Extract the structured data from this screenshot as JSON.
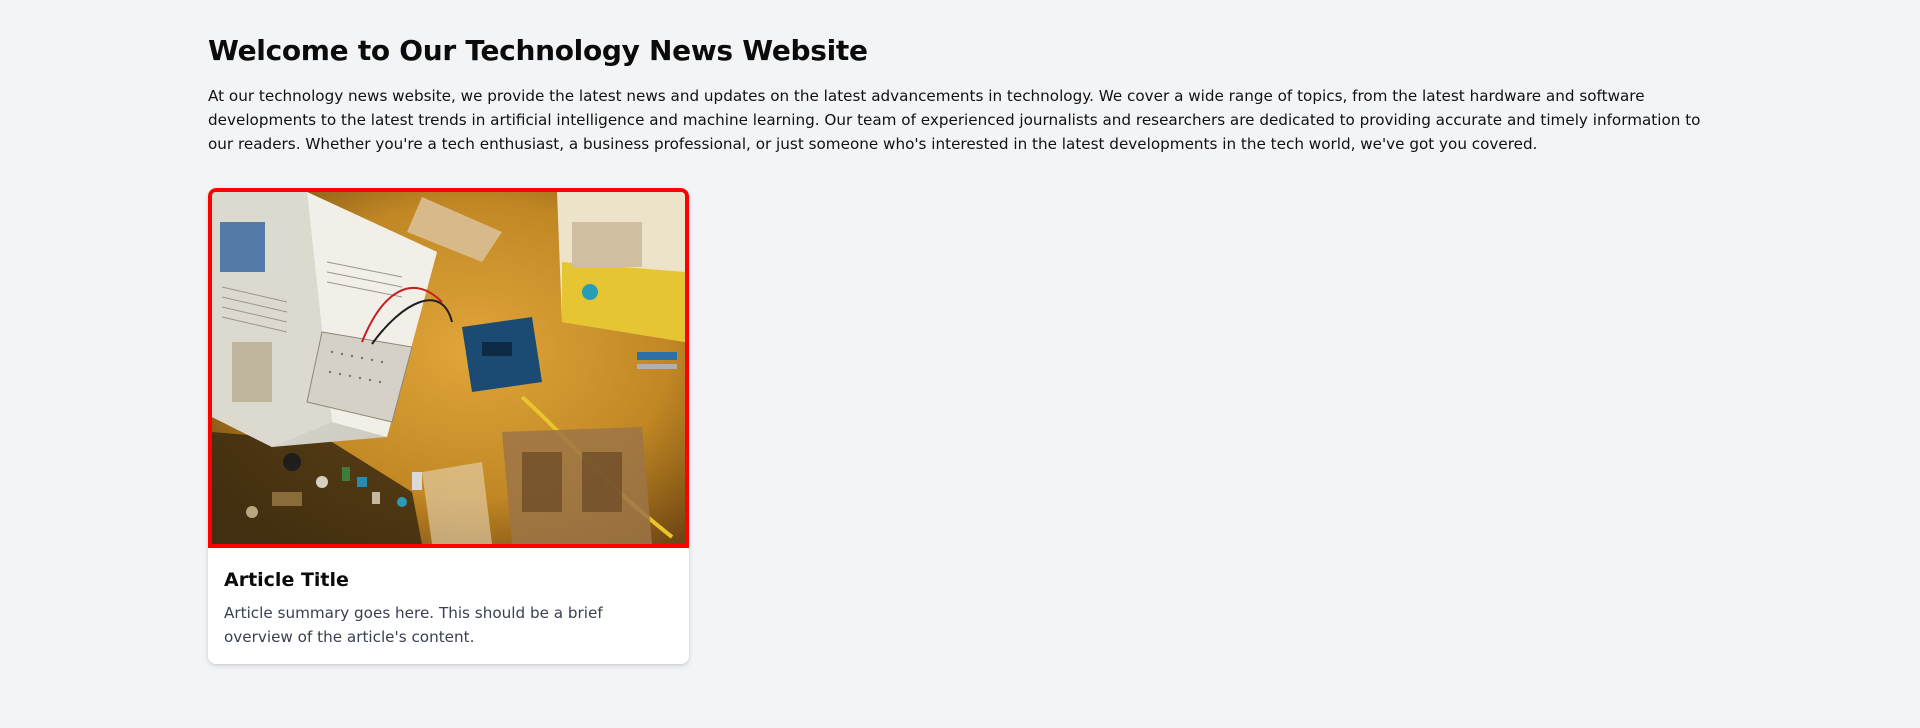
{
  "page": {
    "title": "Welcome to Our Technology News Website",
    "intro": "At our technology news website, we provide the latest news and updates on the latest advancements in technology. We cover a wide range of topics, from the latest hardware and software developments to the latest trends in artificial intelligence and machine learning. Our team of experienced journalists and researchers are dedicated to providing accurate and timely information to our readers. Whether you're a tech enthusiast, a business professional, or just someone who's interested in the latest developments in the tech world, we've got you covered."
  },
  "articles": [
    {
      "title": "Article Title",
      "summary": "Article summary goes here. This should be a brief overview of the article's content.",
      "image_subject": "electronics-workbench-photo"
    }
  ],
  "colors": {
    "background": "#f3f4f6",
    "card": "#ffffff",
    "image_highlight_border": "#ff0000",
    "title_text": "#0b0b0b",
    "summary_text": "#374151"
  }
}
